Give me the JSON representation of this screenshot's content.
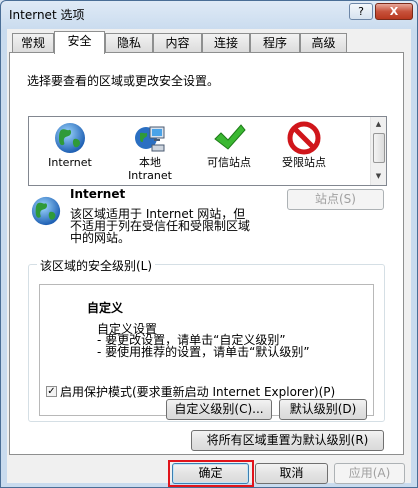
{
  "window": {
    "title": "Internet 选项",
    "help_label": "?",
    "close_label": "X"
  },
  "tabs": [
    {
      "label": "常规"
    },
    {
      "label": "安全"
    },
    {
      "label": "隐私"
    },
    {
      "label": "内容"
    },
    {
      "label": "连接"
    },
    {
      "label": "程序"
    },
    {
      "label": "高级"
    }
  ],
  "active_tab": "安全",
  "security": {
    "select_zone_label": "选择要查看的区域或更改安全设置。",
    "zones": [
      {
        "name": "Internet",
        "icon": "globe-icon"
      },
      {
        "name": "本地\nIntranet",
        "icon": "intranet-icon"
      },
      {
        "name": "可信站点",
        "icon": "checkmark-icon"
      },
      {
        "name": "受限站点",
        "icon": "restricted-icon"
      }
    ],
    "zone_detail": {
      "title": "Internet",
      "description": "该区域适用于 Internet 网站，但\n不适用于列在受信任和受限制区域\n中的网站。",
      "sites_button": "站点(S)"
    },
    "level_group": {
      "title": "该区域的安全级别(L)",
      "level_name": "自定义",
      "lines": [
        "自定义设置",
        "- 要更改设置，请单击“自定义级别”",
        "- 要使用推荐的设置，请单击“默认级别”"
      ]
    },
    "protected_mode": {
      "label": "启用保护模式(要求重新启动 Internet Explorer)(P)",
      "checked": true
    },
    "custom_level_button": "自定义级别(C)...",
    "default_level_button": "默认级别(D)",
    "reset_all_button": "将所有区域重置为默认级别(R)"
  },
  "footer": {
    "ok": "确定",
    "cancel": "取消",
    "apply": "应用(A)"
  },
  "colors": {
    "highlight": "#e0141b",
    "title_bar": "#c9dbee"
  }
}
